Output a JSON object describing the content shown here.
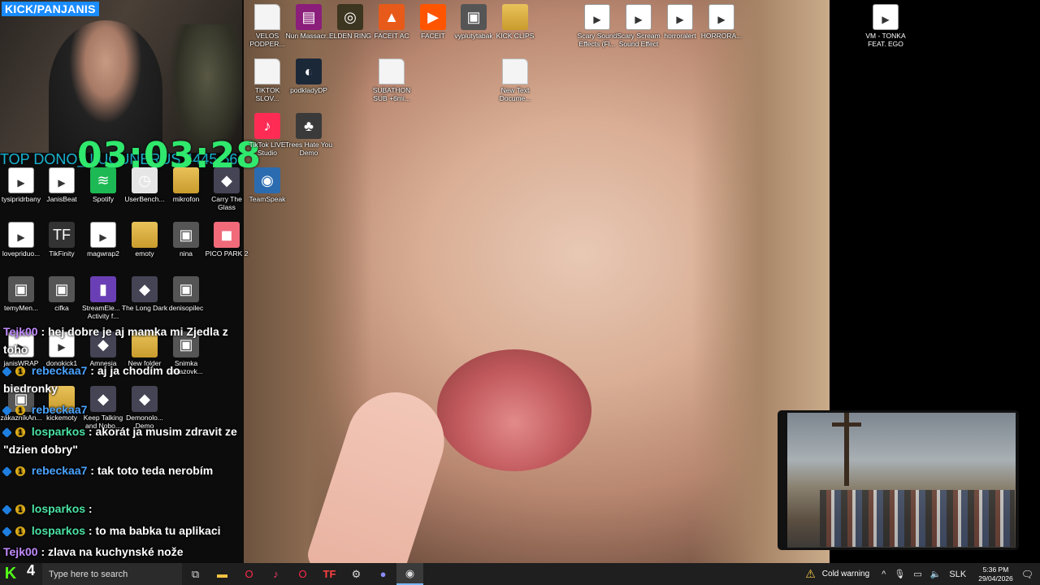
{
  "stream": {
    "channel_tag": "KICK/PANJANIS",
    "timer": "03:03:28",
    "donor_text": "TOP DONO_ LUCUNERUS 4445.56€"
  },
  "desktop": {
    "icons": [
      {
        "label": "VELOS PODPER...",
        "icon": "document-icon"
      },
      {
        "label": "Nun Massacr...",
        "icon": "winrar-icon"
      },
      {
        "label": "ELDEN RING",
        "icon": "elden-ring-icon"
      },
      {
        "label": "FACEIT AC",
        "icon": "faceit-ac-icon"
      },
      {
        "label": "FACEIT",
        "icon": "faceit-icon"
      },
      {
        "label": "vyplutytabak",
        "icon": "image-icon"
      },
      {
        "label": "KICK CLIPS",
        "icon": "folder-icon"
      },
      {
        "label": "Scary Sound Effects (Fl...",
        "icon": "media-icon"
      },
      {
        "label": "Scary Scream Sound Effect",
        "icon": "media-icon"
      },
      {
        "label": "horroralert",
        "icon": "media-icon"
      },
      {
        "label": "HORRORA...",
        "icon": "media-icon"
      },
      {
        "label": "VM - TONKA FEAT. EGO",
        "icon": "media-icon"
      },
      {
        "label": "TIKTOK SLOV...",
        "icon": "document-icon"
      },
      {
        "label": "podkladyDP",
        "icon": "steam-icon"
      },
      {
        "label": "SUBATHON SUB +6mi...",
        "icon": "document-icon"
      },
      {
        "label": "New Text Docume...",
        "icon": "document-icon"
      },
      {
        "label": "TikTok LIVE Studio",
        "icon": "tiktok-icon"
      },
      {
        "label": "Trees Hate You Demo",
        "icon": "tree-icon"
      },
      {
        "label": "tysipridrbany",
        "icon": "media-icon"
      },
      {
        "label": "JanisBeat",
        "icon": "media-icon"
      },
      {
        "label": "Spotify",
        "icon": "spotify-icon"
      },
      {
        "label": "UserBench...",
        "icon": "userbenchmark-icon"
      },
      {
        "label": "mikrofon",
        "icon": "folder-icon"
      },
      {
        "label": "Carry The Glass",
        "icon": "game-icon"
      },
      {
        "label": "TeamSpeak",
        "icon": "teamspeak-icon"
      },
      {
        "label": "lovepriduo...",
        "icon": "media-icon"
      },
      {
        "label": "TikFinity",
        "icon": "tikfinity-icon"
      },
      {
        "label": "magwrap2",
        "icon": "media-icon"
      },
      {
        "label": "emoty",
        "icon": "folder-icon"
      },
      {
        "label": "nina",
        "icon": "image-icon"
      },
      {
        "label": "PICO PARK 2",
        "icon": "pico-park-icon"
      },
      {
        "label": "temyMen...",
        "icon": "image-icon"
      },
      {
        "label": "cifka",
        "icon": "image-icon"
      },
      {
        "label": "StreamEle... - Activity f...",
        "icon": "streamelements-icon"
      },
      {
        "label": "The Long Dark",
        "icon": "game-icon"
      },
      {
        "label": "denisopilec",
        "icon": "image-icon"
      },
      {
        "label": "janisWRAP",
        "icon": "media-icon"
      },
      {
        "label": "donokick1",
        "icon": "media-icon"
      },
      {
        "label": "Amnesia",
        "icon": "game-icon"
      },
      {
        "label": "New folder",
        "icon": "folder-icon"
      },
      {
        "label": "Snimka obrazovk...",
        "icon": "image-icon"
      },
      {
        "label": "zákazníkAn...",
        "icon": "image-icon"
      },
      {
        "label": "kickemoty",
        "icon": "folder-icon"
      },
      {
        "label": "Keep Talking and Nobo...",
        "icon": "game-icon"
      },
      {
        "label": "Demonolo... Demo",
        "icon": "game-icon"
      }
    ]
  },
  "chat": [
    {
      "user": "Tejk00",
      "text": ": hej dobre je aj mamka mi Zjedla z",
      "cont": "toho"
    },
    {
      "user": "rebeckaa7",
      "text": ": aj ja chodím do",
      "cont": "biedronky"
    },
    {
      "user": "rebeckaa7",
      "text": ""
    },
    {
      "user": "losparkos",
      "text": ": akorát ja musim zdravit ze",
      "cont": "\"dzien dobry\""
    },
    {
      "user": "rebeckaa7",
      "text": ": tak toto teda nerobím"
    },
    {
      "user": "losparkos",
      "text": ":"
    },
    {
      "user": "losparkos",
      "text": ": to ma babka tu aplikaci"
    },
    {
      "user": "Tejk00",
      "text": ": zlava na kuchynské nože"
    }
  ],
  "taskbar": {
    "viewer_count": "4",
    "search_placeholder": "Type here to search",
    "weather": "Cold warning",
    "language": "SLK",
    "time": "5:36 PM",
    "date": "29/04/2026"
  },
  "colors": {
    "kick_green": "#53fc18",
    "timer_green": "#2fe86d",
    "donor_cyan": "#19c6e6",
    "channel_tag_bg": "#1a8cff"
  }
}
